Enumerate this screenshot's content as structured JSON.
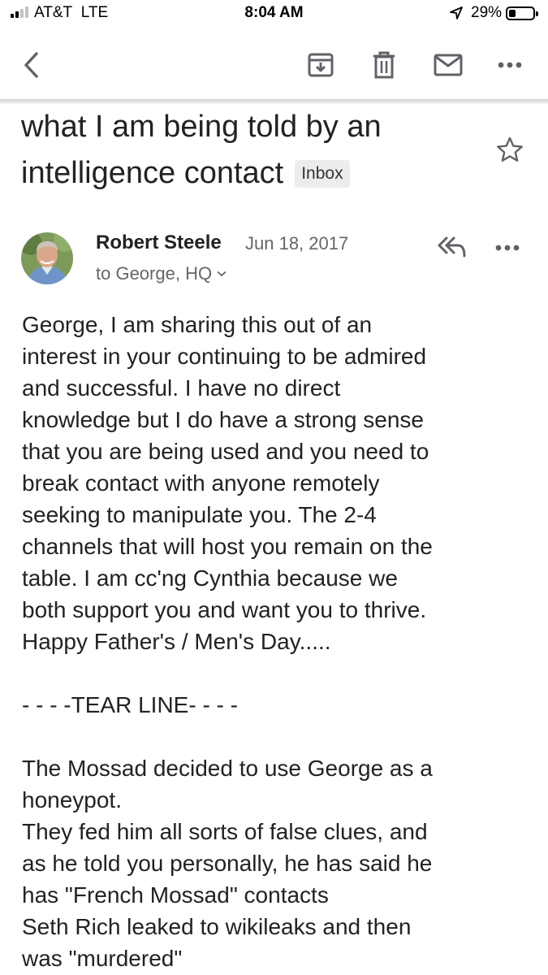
{
  "status_bar": {
    "carrier": "AT&T",
    "network": "LTE",
    "time": "8:04 AM",
    "battery_percent": "29%",
    "battery_level": 0.29,
    "signal_bars": 2
  },
  "toolbar": {
    "back_icon": "chevron-left-icon",
    "archive_icon": "archive-icon",
    "delete_icon": "trash-icon",
    "unread_icon": "mail-icon",
    "more_icon": "more-horizontal-icon"
  },
  "email": {
    "subject_line1": "what I am being told by an",
    "subject_line2": "intelligence contact",
    "label": "Inbox",
    "sender_name": "Robert Steele",
    "date": "Jun 18, 2017",
    "recipients": "to George, HQ",
    "body_paragraph1": "George, I am sharing this out of an\ninterest in your continuing to be admired\nand successful.  I have no direct\nknowledge but I do have a strong sense\nthat you are being used and you need to\nbreak contact with anyone remotely\nseeking to manipulate you.  The 2-4\nchannels that will host you remain on the\ntable.  I am cc'ng Cynthia because we\nboth support you and want you to thrive.\nHappy Father's / Men's Day.....",
    "tear_line": "- - - -TEAR LINE- - - -",
    "body_paragraph2": "The Mossad decided to use George as a\nhoneypot.\nThey fed him all sorts of false clues, and\nas he told you personally, he has said he\nhas \"French Mossad\" contacts\nSeth Rich leaked to wikileaks and then\nwas \"murdered\""
  },
  "colors": {
    "icon_gray": "#5f6368",
    "text": "#222222",
    "secondary_text": "#666666",
    "badge_bg": "#ececec"
  }
}
